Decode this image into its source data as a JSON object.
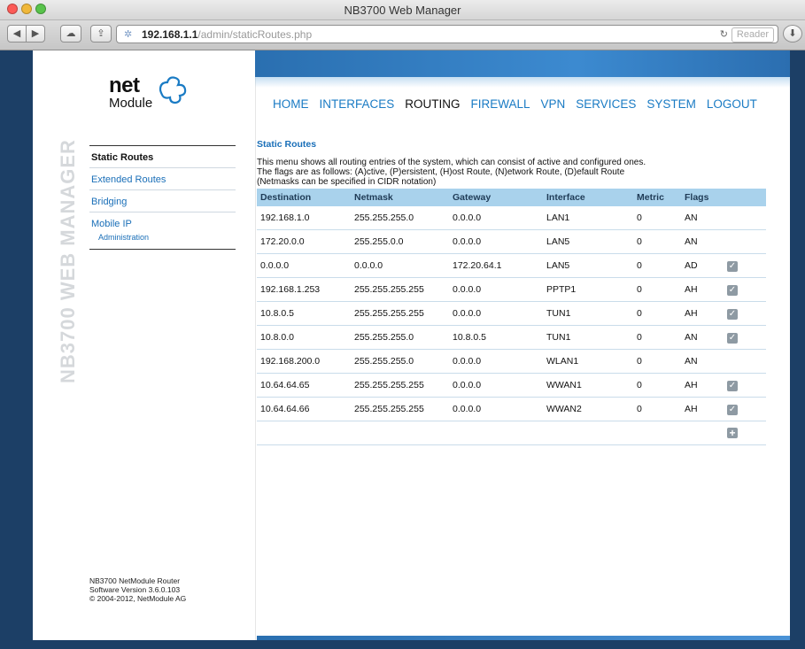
{
  "window": {
    "title": "NB3700 Web Manager"
  },
  "browser": {
    "url_host": "192.168.1.1",
    "url_path": "/admin/staticRoutes.php",
    "reader_label": "Reader"
  },
  "logo": {
    "line1": "net",
    "line2": "Module"
  },
  "vertical_title": "NB3700 WEB MANAGER",
  "nav": [
    {
      "label": "HOME"
    },
    {
      "label": "INTERFACES"
    },
    {
      "label": "ROUTING",
      "active": true
    },
    {
      "label": "FIREWALL"
    },
    {
      "label": "VPN"
    },
    {
      "label": "SERVICES"
    },
    {
      "label": "SYSTEM"
    },
    {
      "label": "LOGOUT"
    }
  ],
  "sidebar": {
    "items": [
      {
        "label": "Static Routes",
        "active": true
      },
      {
        "label": "Extended Routes"
      },
      {
        "label": "Bridging"
      }
    ],
    "mobile_ip": {
      "label": "Mobile IP",
      "sub": "Administration"
    }
  },
  "footer": {
    "line1": "NB3700 NetModule Router",
    "line2": "Software Version 3.6.0.103",
    "line3": "© 2004-2012, NetModule AG"
  },
  "content": {
    "title": "Static Routes",
    "desc1": "This menu shows all routing entries of the system, which can consist of active and configured ones.",
    "desc2": "The flags are as follows: (A)ctive, (P)ersistent, (H)ost Route, (N)etwork Route, (D)efault Route",
    "desc3": "(Netmasks can be specified in CIDR notation)"
  },
  "table": {
    "headers": [
      "Destination",
      "Netmask",
      "Gateway",
      "Interface",
      "Metric",
      "Flags"
    ],
    "rows": [
      {
        "dest": "192.168.1.0",
        "mask": "255.255.255.0",
        "gw": "0.0.0.0",
        "iface": "LAN1",
        "metric": "0",
        "flags": "AN",
        "edit": false
      },
      {
        "dest": "172.20.0.0",
        "mask": "255.255.0.0",
        "gw": "0.0.0.0",
        "iface": "LAN5",
        "metric": "0",
        "flags": "AN",
        "edit": false
      },
      {
        "dest": "0.0.0.0",
        "mask": "0.0.0.0",
        "gw": "172.20.64.1",
        "iface": "LAN5",
        "metric": "0",
        "flags": "AD",
        "edit": true
      },
      {
        "dest": "192.168.1.253",
        "mask": "255.255.255.255",
        "gw": "0.0.0.0",
        "iface": "PPTP1",
        "metric": "0",
        "flags": "AH",
        "edit": true
      },
      {
        "dest": "10.8.0.5",
        "mask": "255.255.255.255",
        "gw": "0.0.0.0",
        "iface": "TUN1",
        "metric": "0",
        "flags": "AH",
        "edit": true
      },
      {
        "dest": "10.8.0.0",
        "mask": "255.255.255.0",
        "gw": "10.8.0.5",
        "iface": "TUN1",
        "metric": "0",
        "flags": "AN",
        "edit": true
      },
      {
        "dest": "192.168.200.0",
        "mask": "255.255.255.0",
        "gw": "0.0.0.0",
        "iface": "WLAN1",
        "metric": "0",
        "flags": "AN",
        "edit": false
      },
      {
        "dest": "10.64.64.65",
        "mask": "255.255.255.255",
        "gw": "0.0.0.0",
        "iface": "WWAN1",
        "metric": "0",
        "flags": "AH",
        "edit": true
      },
      {
        "dest": "10.64.64.66",
        "mask": "255.255.255.255",
        "gw": "0.0.0.0",
        "iface": "WWAN2",
        "metric": "0",
        "flags": "AH",
        "edit": true
      }
    ]
  },
  "icons": {
    "edit": "checkbox-icon",
    "add": "plus-icon"
  },
  "colors": {
    "accent": "#1a7bc4",
    "header_bg": "#a9d2ec",
    "top_bar": "#2a6fb0"
  }
}
